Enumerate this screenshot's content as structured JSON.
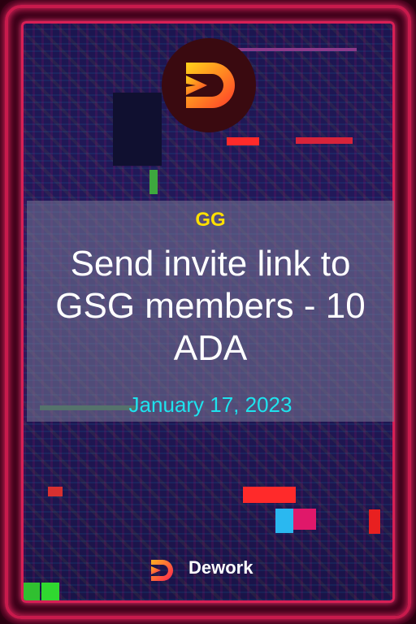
{
  "card": {
    "organization": "GG",
    "title": "Send invite link to GSG members - 10 ADA",
    "date": "January 17, 2023"
  },
  "footer": {
    "brand": "Dework",
    "logo_icon": "dework-logo-icon"
  },
  "colors": {
    "frame": "#d81f55",
    "organization": "#ffe000",
    "title": "#ffffff",
    "date": "#1ee3ee",
    "background": "#1c1650"
  }
}
